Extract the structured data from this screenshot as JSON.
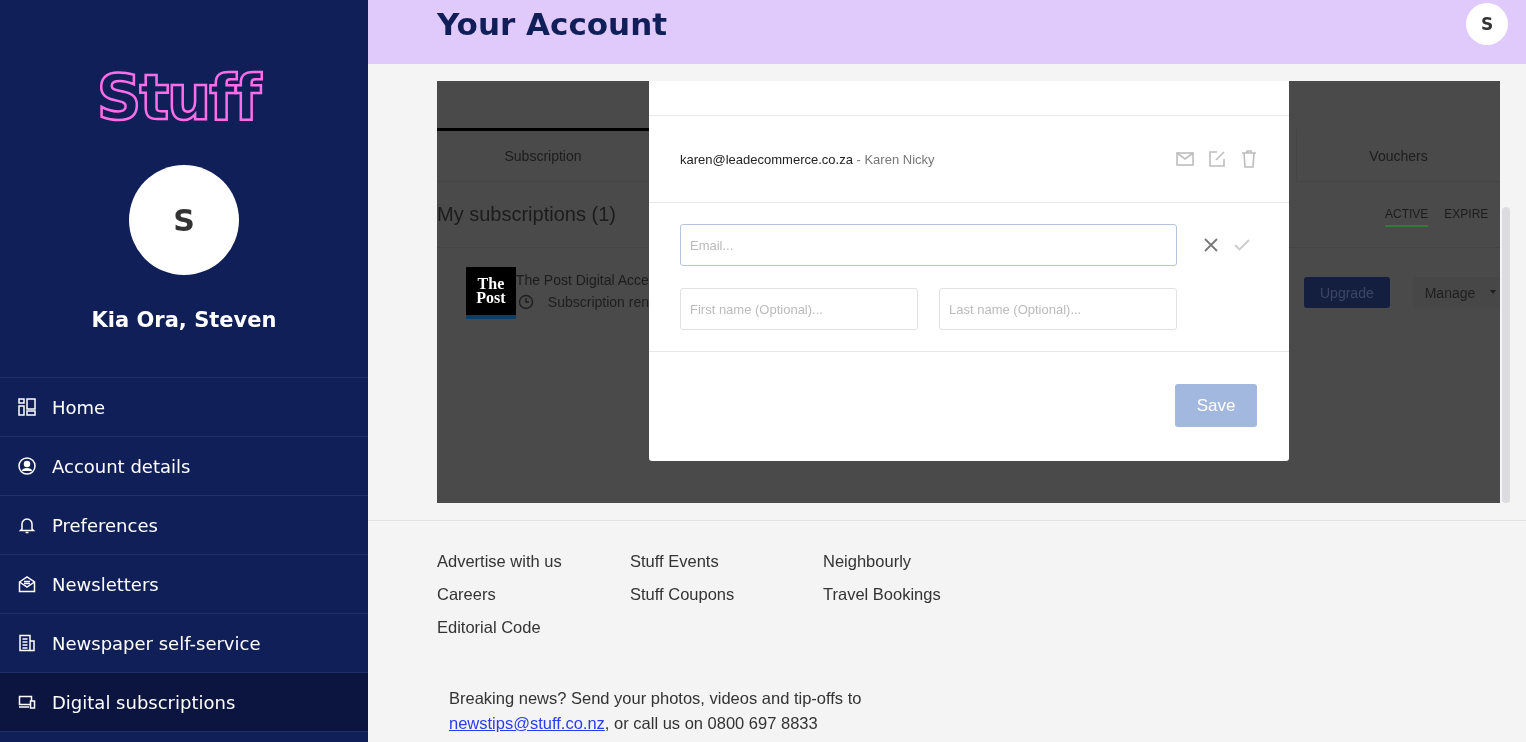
{
  "header": {
    "title": "Your Account",
    "avatar_initial": "S"
  },
  "sidebar": {
    "logo": "Stuff",
    "avatar_initial": "S",
    "greeting": "Kia Ora, Steven",
    "items": [
      {
        "label": "Home",
        "selected": false
      },
      {
        "label": "Account details",
        "selected": false
      },
      {
        "label": "Preferences",
        "selected": false
      },
      {
        "label": "Newsletters",
        "selected": false
      },
      {
        "label": "Newspaper self-service",
        "selected": false
      },
      {
        "label": "Digital subscriptions",
        "selected": true
      }
    ]
  },
  "subscription_panel": {
    "tabs": [
      {
        "label": "Subscription",
        "selected": true
      },
      {
        "label": "Vouchers",
        "selected": false
      }
    ],
    "heading": "My subscriptions (1)",
    "filters": [
      {
        "label": "ACTIVE",
        "selected": true
      },
      {
        "label": "EXPIRE",
        "selected": false
      }
    ],
    "subscription": {
      "logo_lines": [
        "The",
        "Post"
      ],
      "title": "The Post Digital Acce",
      "renewal": "Subscription ren",
      "upgrade_button": "Upgrade",
      "manage_button": "Manage"
    }
  },
  "modal": {
    "recipient": {
      "email": "karen@leadecommerce.co.za",
      "separator": "-",
      "name": "Karen Nicky"
    },
    "email_field": {
      "placeholder": "Email..."
    },
    "first_name_field": {
      "placeholder": "First name (Optional)..."
    },
    "last_name_field": {
      "placeholder": "Last name (Optional)..."
    },
    "save_button": {
      "label": "Save",
      "disabled": true
    }
  },
  "footer": {
    "link_columns": [
      [
        "Advertise with us",
        "Careers",
        "Editorial Code"
      ],
      [
        "Stuff Events",
        "Stuff Coupons"
      ],
      [
        "Neighbourly",
        "Travel Bookings"
      ]
    ],
    "tip": {
      "text_before": "Breaking news? Send your photos, videos and tip-offs to",
      "link": "newstips@stuff.co.nz",
      "text_after": ", or call us on 0800 697 8833"
    }
  }
}
